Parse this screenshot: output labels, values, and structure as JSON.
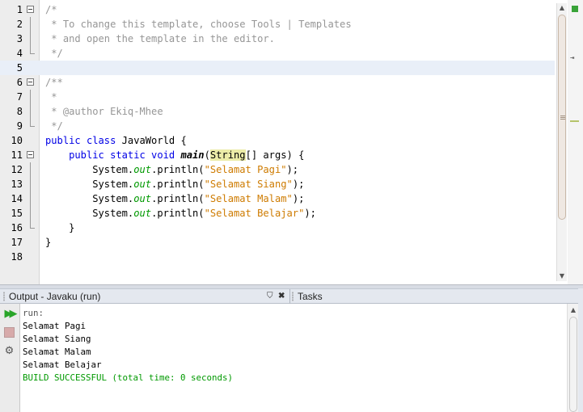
{
  "editor": {
    "lines": [
      {
        "n": "1",
        "fold": "start",
        "current": false,
        "tokens": [
          {
            "t": "/*",
            "c": "cm"
          }
        ]
      },
      {
        "n": "2",
        "fold": "line",
        "current": false,
        "tokens": [
          {
            "t": " * To change this template, choose Tools | Templates",
            "c": "cm"
          }
        ]
      },
      {
        "n": "3",
        "fold": "line",
        "current": false,
        "tokens": [
          {
            "t": " * and open the template in the editor.",
            "c": "cm"
          }
        ]
      },
      {
        "n": "4",
        "fold": "end",
        "current": false,
        "tokens": [
          {
            "t": " */",
            "c": "cm"
          }
        ]
      },
      {
        "n": "5",
        "fold": "",
        "current": true,
        "tokens": []
      },
      {
        "n": "6",
        "fold": "start",
        "current": false,
        "tokens": [
          {
            "t": "/**",
            "c": "cm"
          }
        ]
      },
      {
        "n": "7",
        "fold": "line",
        "current": false,
        "tokens": [
          {
            "t": " *",
            "c": "cm"
          }
        ]
      },
      {
        "n": "8",
        "fold": "line",
        "current": false,
        "tokens": [
          {
            "t": " * @author Ekiq-Mhee",
            "c": "cm"
          }
        ]
      },
      {
        "n": "9",
        "fold": "end",
        "current": false,
        "tokens": [
          {
            "t": " */",
            "c": "cm"
          }
        ]
      },
      {
        "n": "10",
        "fold": "",
        "current": false,
        "tokens": [
          {
            "t": "public class ",
            "c": "kw"
          },
          {
            "t": "JavaWorld {",
            "c": ""
          }
        ]
      },
      {
        "n": "11",
        "fold": "start",
        "current": false,
        "tokens": [
          {
            "t": "    public static void ",
            "c": "kw"
          },
          {
            "t": "main",
            "c": "meth"
          },
          {
            "t": "(",
            "c": ""
          },
          {
            "t": "String",
            "c": "hl"
          },
          {
            "t": "[] args) {",
            "c": ""
          }
        ]
      },
      {
        "n": "12",
        "fold": "line",
        "current": false,
        "tokens": [
          {
            "t": "        System.",
            "c": ""
          },
          {
            "t": "out",
            "c": "fld"
          },
          {
            "t": ".println(",
            "c": ""
          },
          {
            "t": "\"Selamat Pagi\"",
            "c": "str"
          },
          {
            "t": ");",
            "c": ""
          }
        ]
      },
      {
        "n": "13",
        "fold": "line",
        "current": false,
        "tokens": [
          {
            "t": "        System.",
            "c": ""
          },
          {
            "t": "out",
            "c": "fld"
          },
          {
            "t": ".println(",
            "c": ""
          },
          {
            "t": "\"Selamat Siang\"",
            "c": "str"
          },
          {
            "t": ");",
            "c": ""
          }
        ]
      },
      {
        "n": "14",
        "fold": "line",
        "current": false,
        "tokens": [
          {
            "t": "        System.",
            "c": ""
          },
          {
            "t": "out",
            "c": "fld"
          },
          {
            "t": ".println(",
            "c": ""
          },
          {
            "t": "\"Selamat Malam\"",
            "c": "str"
          },
          {
            "t": ");",
            "c": ""
          }
        ]
      },
      {
        "n": "15",
        "fold": "line",
        "current": false,
        "tokens": [
          {
            "t": "        System.",
            "c": ""
          },
          {
            "t": "out",
            "c": "fld"
          },
          {
            "t": ".println(",
            "c": ""
          },
          {
            "t": "\"Selamat Belajar\"",
            "c": "str"
          },
          {
            "t": ");",
            "c": ""
          }
        ]
      },
      {
        "n": "16",
        "fold": "end",
        "current": false,
        "tokens": [
          {
            "t": "    }",
            "c": ""
          }
        ]
      },
      {
        "n": "17",
        "fold": "",
        "current": false,
        "tokens": [
          {
            "t": "}",
            "c": ""
          }
        ]
      },
      {
        "n": "18",
        "fold": "",
        "current": false,
        "tokens": []
      }
    ],
    "scroll_up": "▲",
    "scroll_down": "▼",
    "stripe_caret": "⇥"
  },
  "output": {
    "title": "Output - Javaku (run)",
    "minimize_glyph": "⛉",
    "close_glyph": "✖",
    "tasks_title": "Tasks",
    "rerun_glyph": "▶▶",
    "settings_glyph": "⚙",
    "lines": [
      {
        "text": "run:",
        "kind": "muted"
      },
      {
        "text": "Selamat Pagi",
        "kind": ""
      },
      {
        "text": "Selamat Siang",
        "kind": ""
      },
      {
        "text": "Selamat Malam",
        "kind": ""
      },
      {
        "text": "Selamat Belajar",
        "kind": ""
      },
      {
        "text": "BUILD SUCCESSFUL (total time: 0 seconds)",
        "kind": "success"
      }
    ],
    "scroll_up": "▲"
  },
  "colors": {
    "keyword": "#0000e6",
    "comment": "#969696",
    "string": "#ce7b00",
    "field": "#009900",
    "success": "#009900",
    "current_line": "#e9eff8"
  }
}
